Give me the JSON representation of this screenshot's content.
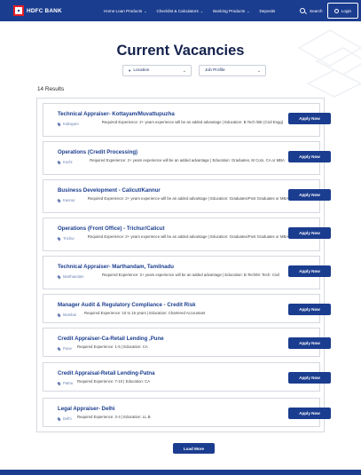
{
  "header": {
    "brand": "HDFC BANK",
    "nav": [
      "Home Loan Products",
      "Checklist & Calculators",
      "Banking Products",
      "Deposits"
    ],
    "search_label": "Search",
    "login_label": "Login"
  },
  "page": {
    "title": "Current Vacancies",
    "results_text": "14 Results",
    "load_more_label": "Load More"
  },
  "filters": {
    "location": "Location",
    "job_profile": "Job Profile"
  },
  "jobs": [
    {
      "title": "Technical Appraiser- Kottayam/Muvattupuzha",
      "location": "Kottayam",
      "requirement": "Required Experience: 2+ years experience will be an added advantage | Education: B.Tech /BE (Civil Engg)",
      "apply": "Apply Now"
    },
    {
      "title": "Operations (Credit Processing)",
      "location": "Kochi",
      "requirement": "Required Experience: 2+ years experience will be an added advantage | Education: Graduates, M Com, CA or MBA",
      "apply": "Apply Now"
    },
    {
      "title": "Business Development - Calicut/Kannur",
      "location": "Kannur",
      "requirement": "Required Experience: 2+ years experience will be an added advantage | Education: Graduates/Post Graduates or MBA",
      "apply": "Apply Now"
    },
    {
      "title": "Operations (Front Office) - Trichur/Calicut",
      "location": "Trichur",
      "requirement": "Required Experience: 2+ years experience will be an added advantage | Education: Graduates/Post Graduates or MBA",
      "apply": "Apply Now"
    },
    {
      "title": "Technical Appraiser- Marthandam, Tamilnadu",
      "location": "Marthandam",
      "requirement": "Required Experience: 2+ years experience will be an added advantage | Education: B.Tech/M. Tech- Civil",
      "apply": "Apply Now"
    },
    {
      "title": "Manager Audit & Regulatory Compliance - Credit Risk",
      "location": "Mumbai",
      "requirement": "Required Experience: 10 to 15 years | Education: Chartered Accountant",
      "apply": "Apply Now"
    },
    {
      "title": "Credit Appraiser-Ca-Retail Lending ,Pune",
      "location": "Pune",
      "requirement": "Required Experience: 1-5 | Education: CA",
      "apply": "Apply Now"
    },
    {
      "title": "Credit Appraisal-Retail Lending-Patna",
      "location": "Patna",
      "requirement": "Required Experience: 7-10 | Education: CA",
      "apply": "Apply Now"
    },
    {
      "title": "Legal Appraiser- Delhi",
      "location": "Delhi",
      "requirement": "Required Experience: 2-4 | Education: LL.B",
      "apply": "Apply Now"
    }
  ]
}
